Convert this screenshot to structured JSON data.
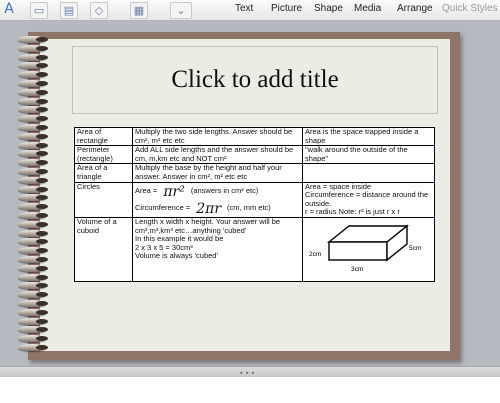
{
  "toolbar": {
    "menus": [
      "Text",
      "Picture",
      "Shape",
      "Media",
      "Arrange",
      "Quick Styles"
    ],
    "icons": [
      "text-box-icon",
      "insert-icon",
      "shape-icon",
      "chart-icon",
      "dropdown-icon",
      "layout-icon"
    ]
  },
  "slide": {
    "title_placeholder": "Click to add title",
    "rows": [
      {
        "shape": "Area of rectangle",
        "method": "Multiply the two side lengths. Answer should be cm², m² etc etc",
        "notes": "Area is the space trapped inside a shape"
      },
      {
        "shape": "Perimeter (rectangle)",
        "method": "Add ALL side lengths and the answer should be cm, m,km etc and NOT cm²",
        "notes": "\"walk around the outside of the shape\""
      },
      {
        "shape": "Area of a triangle",
        "method": "Multiply the base by the height and half your answer. Answer in cm², m² etc etc",
        "notes": ""
      },
      {
        "shape": "Circles",
        "area_label": "Area =",
        "area_formula": "πr²",
        "area_units": "(answers in cm² etc)",
        "circ_label": "Circumference =",
        "circ_formula": "2πr",
        "circ_units": "(cm, mm etc)",
        "notes": "Area = space inside\nCircumference = distance around the outside.\nr = radius Note: r² is just r x r"
      },
      {
        "shape": "Volume of a cuboid",
        "method": "Length x width x height. Your answer will be cm³,m³,km³ etc…anything 'cubed'\nIn this example it would be\n2 x 3 x 5 = 30cm³\nVolume is always 'cubed'",
        "diagram": {
          "height_label": "2cm",
          "depth_label": "5cm",
          "width_label": "3cm"
        }
      }
    ]
  },
  "bottom": {
    "grip": "•••"
  }
}
